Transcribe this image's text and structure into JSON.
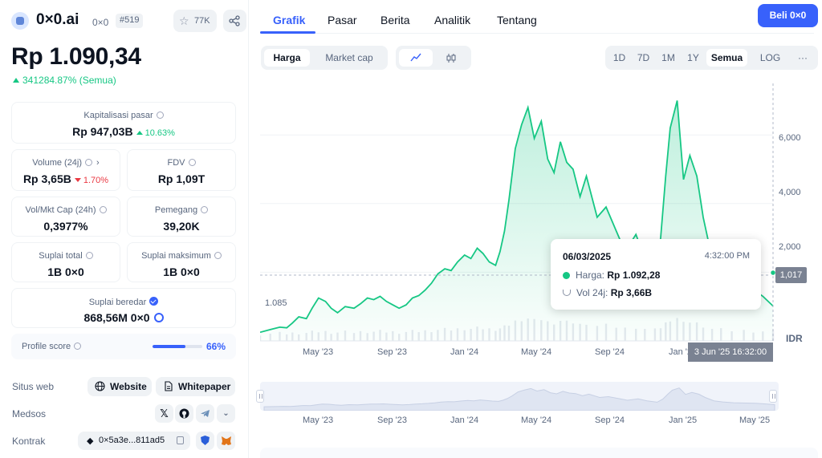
{
  "coin": {
    "name": "0×0.ai",
    "symbol": "0×0",
    "rank": "#519",
    "watchlist_count": "77K",
    "price": "Rp 1.090,34",
    "change_all": "341284.87% (Semua)"
  },
  "stats": {
    "market_cap": {
      "label": "Kapitalisasi pasar",
      "value": "Rp 947,03B",
      "change": "10.63%"
    },
    "volume": {
      "label": "Volume (24j)",
      "value": "Rp 3,65B",
      "change": "1.70%"
    },
    "fdv": {
      "label": "FDV",
      "value": "Rp 1,09T"
    },
    "vol_mkt_cap": {
      "label": "Vol/Mkt Cap (24h)",
      "value": "0,3977%"
    },
    "holders": {
      "label": "Pemegang",
      "value": "39,20K"
    },
    "total_supply": {
      "label": "Suplai total",
      "value": "1B 0×0"
    },
    "max_supply": {
      "label": "Suplai maksimum",
      "value": "1B 0×0"
    },
    "circulating_supply": {
      "label": "Suplai beredar",
      "value": "868,56M 0×0"
    }
  },
  "profile": {
    "label": "Profile score",
    "value": "66%",
    "level": 0.66
  },
  "links": {
    "website_label": "Situs web",
    "website": "Website",
    "whitepaper": "Whitepaper",
    "socials_label": "Medsos",
    "contract_label": "Kontrak",
    "contract_address": "0×5a3e...811ad5",
    "socials": [
      "x-icon",
      "github-icon",
      "telegram-icon",
      "chevron-down-icon"
    ]
  },
  "tabs": [
    "Grafik",
    "Pasar",
    "Berita",
    "Analitik",
    "Tentang"
  ],
  "buy_label": "Beli 0×0",
  "chart_controls": {
    "metric": [
      "Harga",
      "Market cap"
    ],
    "metric_selected": "Harga",
    "chart_type": [
      "line-chart-icon",
      "candlestick-icon"
    ],
    "ranges": [
      "1D",
      "7D",
      "1M",
      "1Y",
      "Semua"
    ],
    "range_selected": "Semua",
    "log": "LOG",
    "more": "···"
  },
  "tooltip": {
    "date": "06/03/2025",
    "time": "4:32:00 PM",
    "price_label": "Harga:",
    "price_value": "Rp 1.092,28",
    "vol_label": "Vol 24j:",
    "vol_value": "Rp 3,66B"
  },
  "chart_labels": {
    "current_price": "1,017",
    "start_price": "1.085",
    "crosshair_time": "3 Jun '25 16:32:00",
    "currency": "IDR"
  },
  "chart_data": {
    "type": "area",
    "y_ticks": [
      "2,000",
      "4,000",
      "6,000"
    ],
    "ylim": [
      0,
      7500
    ],
    "x_ticks": [
      "May '23",
      "Sep '23",
      "Jan '24",
      "May '24",
      "Sep '24",
      "Jan '25"
    ],
    "navigator_x_ticks": [
      "May '23",
      "Sep '23",
      "Jan '24",
      "May '24",
      "Sep '24",
      "Jan '25",
      "May '25"
    ],
    "x_range": [
      "2023-03-20",
      "2025-06-05"
    ],
    "series": [
      {
        "x": [
          "2023-03-20",
          "2023-04-05",
          "2023-04-20",
          "2023-05-01",
          "2023-05-10",
          "2023-05-20",
          "2023-06-01",
          "2023-06-10",
          "2023-06-20",
          "2023-07-01",
          "2023-07-10",
          "2023-07-20",
          "2023-08-01",
          "2023-08-15",
          "2023-08-25",
          "2023-09-05",
          "2023-09-15",
          "2023-09-25",
          "2023-10-05",
          "2023-10-15",
          "2023-10-25",
          "2023-11-05",
          "2023-11-15",
          "2023-11-25",
          "2023-12-05",
          "2023-12-15",
          "2023-12-25",
          "2024-01-05",
          "2024-01-15",
          "2024-01-25",
          "2024-02-05",
          "2024-02-15",
          "2024-02-25",
          "2024-03-05",
          "2024-03-15",
          "2024-03-25",
          "2024-04-01",
          "2024-04-08",
          "2024-04-15",
          "2024-04-25",
          "2024-05-05",
          "2024-05-15",
          "2024-05-25",
          "2024-06-05",
          "2024-06-15",
          "2024-06-25",
          "2024-07-05",
          "2024-07-15",
          "2024-07-25",
          "2024-08-05",
          "2024-08-15",
          "2024-09-01",
          "2024-09-15",
          "2024-10-01",
          "2024-10-15",
          "2024-11-01",
          "2024-11-15",
          "2024-12-01",
          "2024-12-10",
          "2024-12-18",
          "2024-12-25",
          "2025-01-05",
          "2025-01-15",
          "2025-01-25",
          "2025-02-05",
          "2025-02-15",
          "2025-03-01",
          "2025-03-15",
          "2025-04-01",
          "2025-04-20",
          "2025-05-05",
          "2025-05-20",
          "2025-06-05"
        ],
        "values": [
          250,
          330,
          400,
          380,
          520,
          700,
          650,
          950,
          1250,
          1150,
          950,
          820,
          1000,
          950,
          1080,
          1250,
          1200,
          1300,
          1150,
          1050,
          950,
          1050,
          1250,
          1320,
          1480,
          1680,
          1950,
          2100,
          2050,
          2300,
          2500,
          2400,
          2700,
          2550,
          2300,
          2200,
          2600,
          3200,
          4100,
          5600,
          6300,
          6800,
          5900,
          6400,
          5300,
          4900,
          5800,
          5200,
          5000,
          4200,
          4800,
          3600,
          3900,
          3200,
          2600,
          3100,
          2400,
          1900,
          3000,
          4800,
          6200,
          7000,
          4700,
          5400,
          4800,
          3600,
          2400,
          2000,
          1700,
          1600,
          1500,
          1300,
          1017
        ]
      }
    ]
  }
}
